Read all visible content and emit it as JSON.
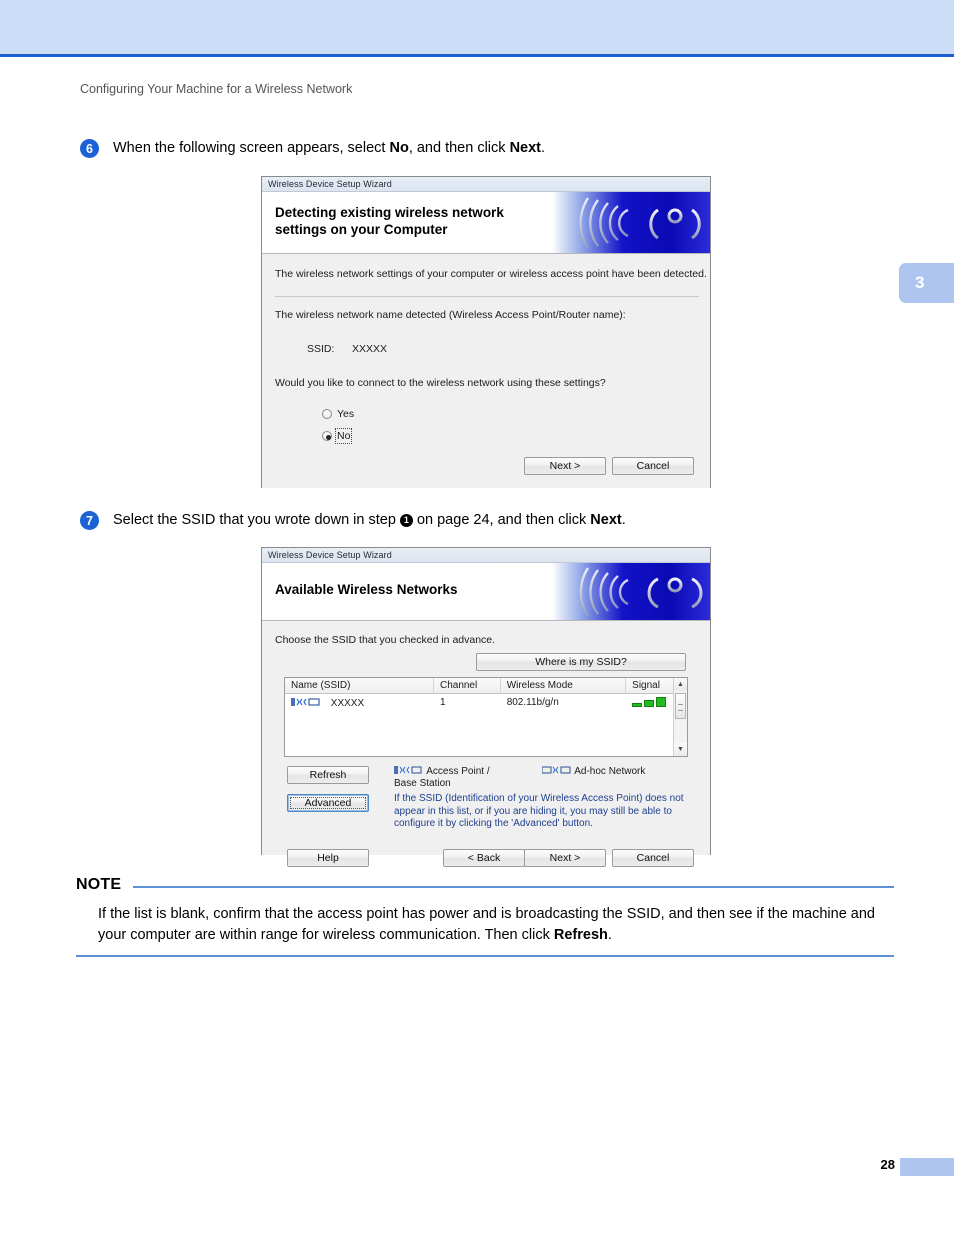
{
  "page": {
    "running_head": "Configuring Your Machine for a Wireless Network",
    "chapter_marker": "3",
    "page_number": "28"
  },
  "steps": [
    {
      "number": "6",
      "text_before": "When the following screen appears, select ",
      "bold1": "No",
      "text_middle": ", and then click ",
      "bold2": "Next",
      "text_after": "."
    },
    {
      "number": "7",
      "text_before": "Select the SSID that you wrote down in step ",
      "badge": "1",
      "text_middle": " on page 24, and then click ",
      "bold2": "Next",
      "text_after": "."
    }
  ],
  "dialog1": {
    "titlebar": "Wireless Device Setup Wizard",
    "banner_title_line1": "Detecting existing wireless network",
    "banner_title_line2": "settings on your Computer",
    "intro": "The wireless network settings of your computer or wireless access point have been detected.",
    "detected_label": "The wireless network name detected (Wireless Access Point/Router name):",
    "ssid_label": "SSID:",
    "ssid_value": "XXXXX",
    "question": "Would you like to connect to the wireless network using these settings?",
    "radio_yes": "Yes",
    "radio_no": "No",
    "selected_radio": "No",
    "btn_next": "Next >",
    "btn_cancel": "Cancel"
  },
  "dialog2": {
    "titlebar": "Wireless Device Setup Wizard",
    "banner_title": "Available Wireless Networks",
    "intro": "Choose the SSID that you checked in advance.",
    "btn_where_ssid": "Where is my SSID?",
    "columns": [
      "Name (SSID)",
      "Channel",
      "Wireless Mode",
      "Signal"
    ],
    "rows": [
      {
        "name": "XXXXX",
        "channel": "1",
        "mode": "802.11b/g/n",
        "signal_bars": 3
      }
    ],
    "btn_refresh": "Refresh",
    "btn_advanced": "Advanced",
    "legend_access_point": "Access Point / Base Station",
    "legend_adhoc": "Ad-hoc Network",
    "help_text": "If the SSID (Identification of your Wireless Access Point) does not appear in this list, or if you are hiding it, you may still be able to configure it by clicking the 'Advanced' button.",
    "btn_help": "Help",
    "btn_back": "< Back",
    "btn_next": "Next >",
    "btn_cancel": "Cancel"
  },
  "note": {
    "label": "NOTE",
    "text_before": "If the list is blank, confirm that the access point has power and is broadcasting the SSID, and then see if the machine and your computer are within range for wireless communication. Then click ",
    "bold": "Refresh",
    "text_after": "."
  },
  "colors": {
    "accent_blue": "#1c62d6",
    "band_blue": "#cbdcf7",
    "rule_blue": "#5f8fd4",
    "signal_green": "#22bb22"
  }
}
